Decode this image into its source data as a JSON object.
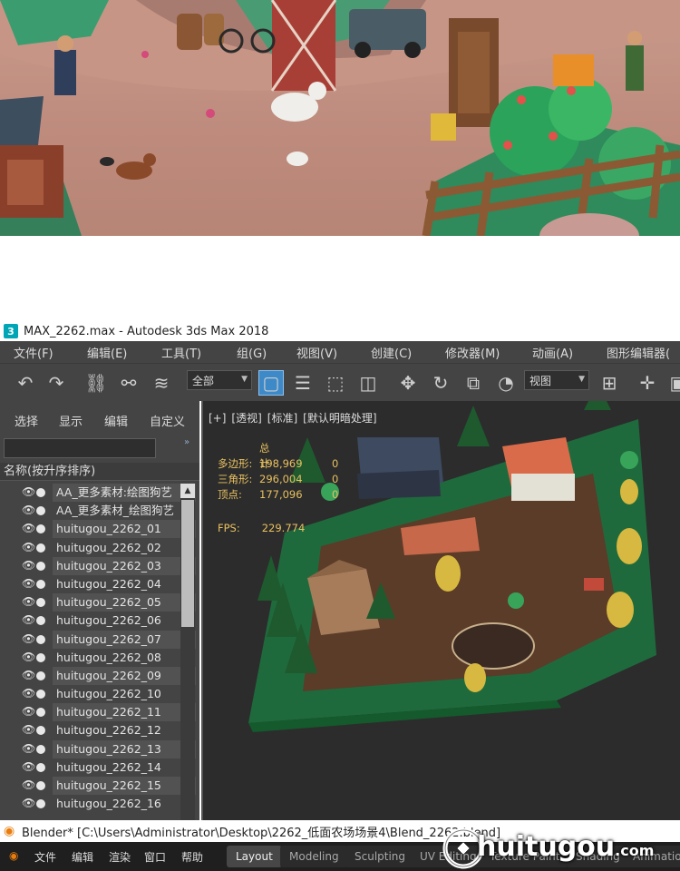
{
  "max_window": {
    "title": "MAX_2262.max - Autodesk 3ds Max 2018",
    "icon_label": "3",
    "menu": [
      "文件(F)",
      "编辑(E)",
      "工具(T)",
      "组(G)",
      "视图(V)",
      "创建(C)",
      "修改器(M)",
      "动画(A)",
      "图形编辑器("
    ],
    "toolbar": {
      "selection_filter": "全部",
      "reference_coord": "视图"
    }
  },
  "explorer": {
    "tabs": [
      "选择",
      "显示",
      "编辑",
      "自定义"
    ],
    "collapse_glyph": "»",
    "search_value": "",
    "column_header": "名称(按升序排序)",
    "items": [
      "AA_更多素材:绘图狗艺",
      "AA_更多素材_绘图狗艺",
      "huitugou_2262_01",
      "huitugou_2262_02",
      "huitugou_2262_03",
      "huitugou_2262_04",
      "huitugou_2262_05",
      "huitugou_2262_06",
      "huitugou_2262_07",
      "huitugou_2262_08",
      "huitugou_2262_09",
      "huitugou_2262_10",
      "huitugou_2262_11",
      "huitugou_2262_12",
      "huitugou_2262_13",
      "huitugou_2262_14",
      "huitugou_2262_15",
      "huitugou_2262_16"
    ]
  },
  "viewport": {
    "labels": [
      "[+]",
      "[透视]",
      "[标准]",
      "[默认明暗处理]"
    ],
    "stats": {
      "header": "总计",
      "rows": [
        {
          "label": "多边形:",
          "value": "198,969",
          "extra": "0"
        },
        {
          "label": "三角形:",
          "value": "296,004",
          "extra": "0"
        },
        {
          "label": "顶点:",
          "value": "177,096",
          "extra": "0"
        }
      ],
      "fps_label": "FPS:",
      "fps_value": "229.774"
    }
  },
  "blender": {
    "title": "Blender* [C:\\Users\\Administrator\\Desktop\\2262_低面农场场景4\\Blend_2262.blend]",
    "menu": [
      "文件",
      "编辑",
      "渲染",
      "窗口",
      "帮助"
    ],
    "workspaces": [
      "Layout",
      "Modeling",
      "Sculpting",
      "UV Editing",
      "Texture Paint",
      "Shading",
      "Animation"
    ],
    "active_workspace": "Layout"
  },
  "watermark": {
    "main": "huitugou",
    "suffix": ".com"
  },
  "colors": {
    "ui_dark": "#444444",
    "viewport_bg": "#2c2c2c",
    "stats_text": "#e8c060",
    "active_tool": "#3e89c7",
    "blender_orange": "#e87d0d"
  }
}
